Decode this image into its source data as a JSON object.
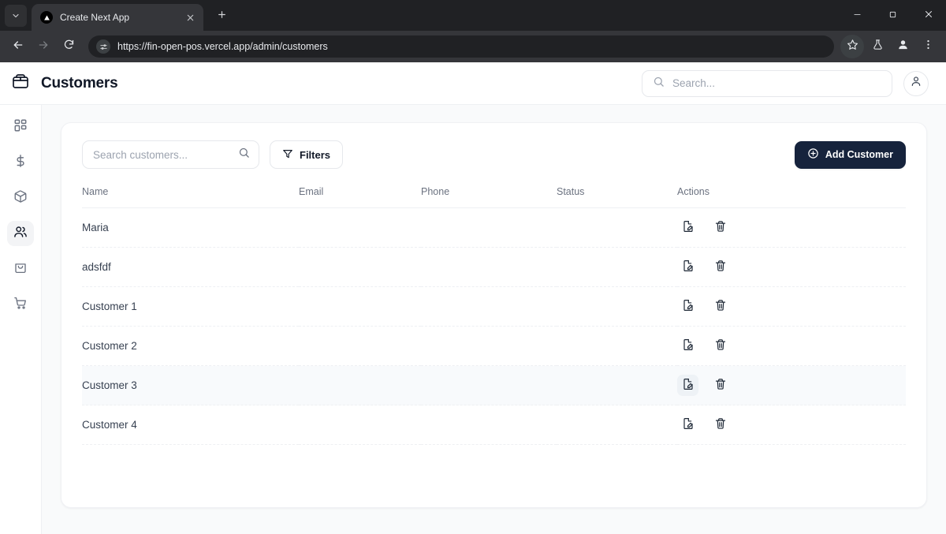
{
  "browser": {
    "tab": {
      "title": "Create Next App",
      "favicon": "nextjs-triangle-icon",
      "close_icon": "close-icon"
    },
    "new_tab_icon": "plus-icon",
    "tab_list_icon": "chevron-down-icon",
    "window_controls": {
      "minimize": "minimize-icon",
      "maximize": "maximize-icon",
      "close": "close-icon"
    },
    "nav": {
      "back_icon": "arrow-left-icon",
      "forward_icon": "arrow-right-icon",
      "reload_icon": "reload-icon"
    },
    "omnibox": {
      "site_settings_icon": "tune-icon",
      "url": "https://fin-open-pos.vercel.app/admin/customers"
    },
    "toolbar_icons": {
      "bookmark": "star-icon",
      "experiments": "flask-icon",
      "profile": "profile-avatar-icon",
      "menu": "three-dot-menu-icon"
    }
  },
  "app": {
    "header": {
      "logo_icon": "shopping-bag-icon",
      "title": "Customers",
      "search": {
        "icon": "search-icon",
        "value": "",
        "placeholder": "Search..."
      },
      "account_icon": "user-icon"
    },
    "sidebar": {
      "items": [
        {
          "name": "dashboard",
          "icon": "grid-dashboard-icon",
          "active": false
        },
        {
          "name": "finance",
          "icon": "dollar-icon",
          "active": false
        },
        {
          "name": "products",
          "icon": "box-package-icon",
          "active": false
        },
        {
          "name": "customers",
          "icon": "users-icon",
          "active": true
        },
        {
          "name": "orders",
          "icon": "shopping-bag-icon",
          "active": false
        },
        {
          "name": "pos",
          "icon": "shopping-cart-icon",
          "active": false
        }
      ]
    },
    "toolbar": {
      "search": {
        "icon": "search-icon",
        "value": "",
        "placeholder": "Search customers..."
      },
      "filters_label": "Filters",
      "filters_icon": "filter-funnel-icon",
      "add_label": "Add Customer",
      "add_icon": "plus-circle-icon"
    },
    "table": {
      "columns": [
        "Name",
        "Email",
        "Phone",
        "Status",
        "Actions"
      ],
      "row_actions": {
        "edit_icon": "file-edit-icon",
        "delete_icon": "trash-icon"
      },
      "rows": [
        {
          "name": "Maria",
          "email": "",
          "phone": "",
          "status": "",
          "hovered": false,
          "edit_hovered": false
        },
        {
          "name": "adsfdf",
          "email": "",
          "phone": "",
          "status": "",
          "hovered": false,
          "edit_hovered": false
        },
        {
          "name": "Customer 1",
          "email": "",
          "phone": "",
          "status": "",
          "hovered": false,
          "edit_hovered": false
        },
        {
          "name": "Customer 2",
          "email": "",
          "phone": "",
          "status": "",
          "hovered": false,
          "edit_hovered": false
        },
        {
          "name": "Customer 3",
          "email": "",
          "phone": "",
          "status": "",
          "hovered": true,
          "edit_hovered": true
        },
        {
          "name": "Customer 4",
          "email": "",
          "phone": "",
          "status": "",
          "hovered": false,
          "edit_hovered": false
        }
      ]
    }
  },
  "colors": {
    "accent_dark": "#16233c",
    "page_bg": "#f9fafb",
    "card_bg": "#ffffff",
    "chrome_bg": "#202124",
    "chrome_toolbar": "#35363a",
    "text_primary": "#111827",
    "text_secondary": "#6b7280",
    "row_hover": "#f8fafc"
  }
}
